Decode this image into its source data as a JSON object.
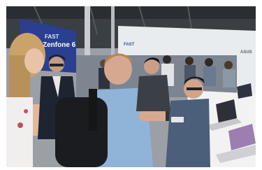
{
  "photo": {
    "signs": {
      "left_banner": "Zenfone 6",
      "left_banner_sub": "FAST",
      "center_banner": "FAST",
      "brand_logo": "ASUS"
    },
    "colors": {
      "ceiling": "#2e3236",
      "banner_blue": "#2a3f8f",
      "wall_white": "#e9ecef",
      "table_white": "#f2f2f2",
      "shirt_blue": "#8fb4d8",
      "hair_blonde": "#caa36a"
    }
  }
}
